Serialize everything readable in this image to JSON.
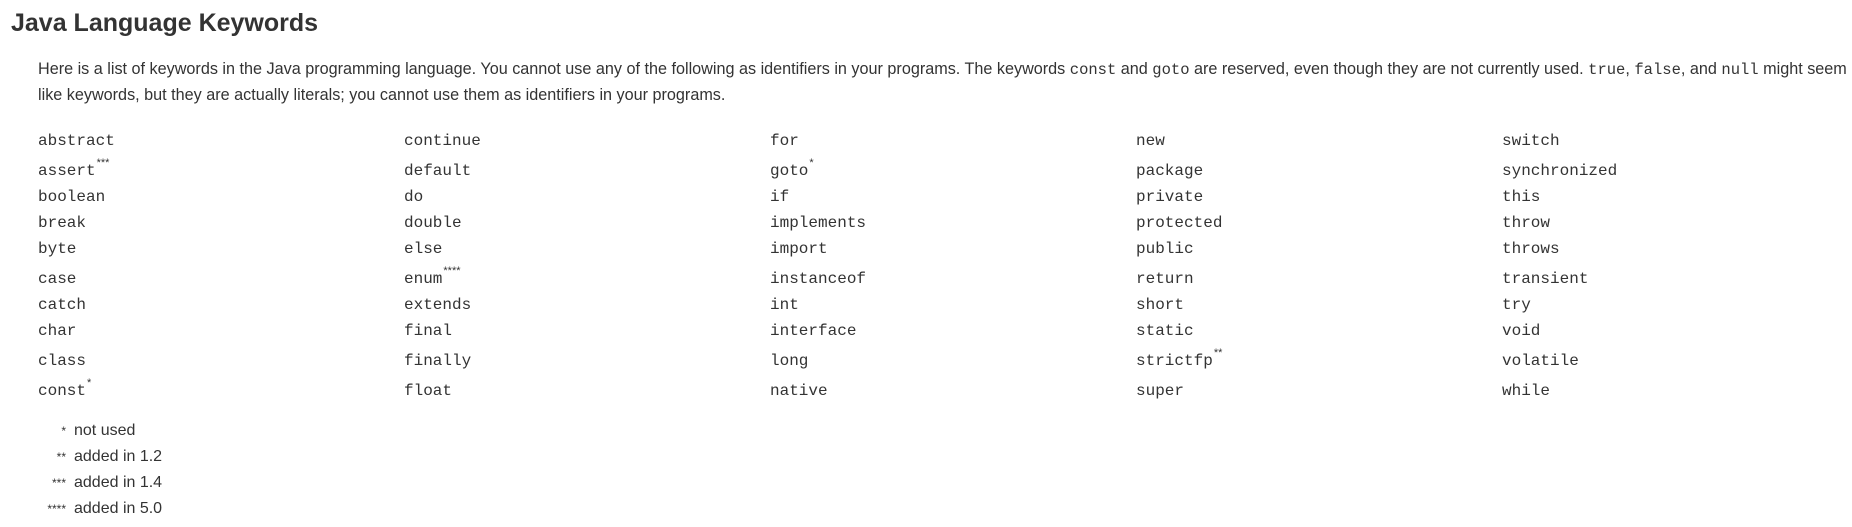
{
  "page": {
    "title": "Java Language Keywords",
    "intro": {
      "p1": "Here is a list of keywords in the Java programming language. You cannot use any of the following as identifiers in your programs. The keywords ",
      "code1": "const",
      "p2": " and ",
      "code2": "goto",
      "p3": " are reserved, even though they are not currently used. ",
      "code3": "true",
      "p4": ", ",
      "code4": "false",
      "p5": ", and ",
      "code5": "null",
      "p6": " might seem like keywords, but they are actually literals; you cannot use them as identifiers in your programs."
    }
  },
  "keywords": [
    [
      {
        "word": "abstract",
        "mark": ""
      },
      {
        "word": "continue",
        "mark": ""
      },
      {
        "word": "for",
        "mark": ""
      },
      {
        "word": "new",
        "mark": ""
      },
      {
        "word": "switch",
        "mark": ""
      }
    ],
    [
      {
        "word": "assert",
        "mark": "***"
      },
      {
        "word": "default",
        "mark": ""
      },
      {
        "word": "goto",
        "mark": "*"
      },
      {
        "word": "package",
        "mark": ""
      },
      {
        "word": "synchronized",
        "mark": ""
      }
    ],
    [
      {
        "word": "boolean",
        "mark": ""
      },
      {
        "word": "do",
        "mark": ""
      },
      {
        "word": "if",
        "mark": ""
      },
      {
        "word": "private",
        "mark": ""
      },
      {
        "word": "this",
        "mark": ""
      }
    ],
    [
      {
        "word": "break",
        "mark": ""
      },
      {
        "word": "double",
        "mark": ""
      },
      {
        "word": "implements",
        "mark": ""
      },
      {
        "word": "protected",
        "mark": ""
      },
      {
        "word": "throw",
        "mark": ""
      }
    ],
    [
      {
        "word": "byte",
        "mark": ""
      },
      {
        "word": "else",
        "mark": ""
      },
      {
        "word": "import",
        "mark": ""
      },
      {
        "word": "public",
        "mark": ""
      },
      {
        "word": "throws",
        "mark": ""
      }
    ],
    [
      {
        "word": "case",
        "mark": ""
      },
      {
        "word": "enum",
        "mark": "****"
      },
      {
        "word": "instanceof",
        "mark": ""
      },
      {
        "word": "return",
        "mark": ""
      },
      {
        "word": "transient",
        "mark": ""
      }
    ],
    [
      {
        "word": "catch",
        "mark": ""
      },
      {
        "word": "extends",
        "mark": ""
      },
      {
        "word": "int",
        "mark": ""
      },
      {
        "word": "short",
        "mark": ""
      },
      {
        "word": "try",
        "mark": ""
      }
    ],
    [
      {
        "word": "char",
        "mark": ""
      },
      {
        "word": "final",
        "mark": ""
      },
      {
        "word": "interface",
        "mark": ""
      },
      {
        "word": "static",
        "mark": ""
      },
      {
        "word": "void",
        "mark": ""
      }
    ],
    [
      {
        "word": "class",
        "mark": ""
      },
      {
        "word": "finally",
        "mark": ""
      },
      {
        "word": "long",
        "mark": ""
      },
      {
        "word": "strictfp",
        "mark": "**"
      },
      {
        "word": "volatile",
        "mark": ""
      }
    ],
    [
      {
        "word": "const",
        "mark": "*"
      },
      {
        "word": "float",
        "mark": ""
      },
      {
        "word": "native",
        "mark": ""
      },
      {
        "word": "super",
        "mark": ""
      },
      {
        "word": "while",
        "mark": ""
      }
    ]
  ],
  "notes": [
    {
      "mark": "*",
      "text": "not used"
    },
    {
      "mark": "**",
      "text": "added in 1.2"
    },
    {
      "mark": "***",
      "text": "added in 1.4"
    },
    {
      "mark": "****",
      "text": "added in 5.0"
    }
  ]
}
